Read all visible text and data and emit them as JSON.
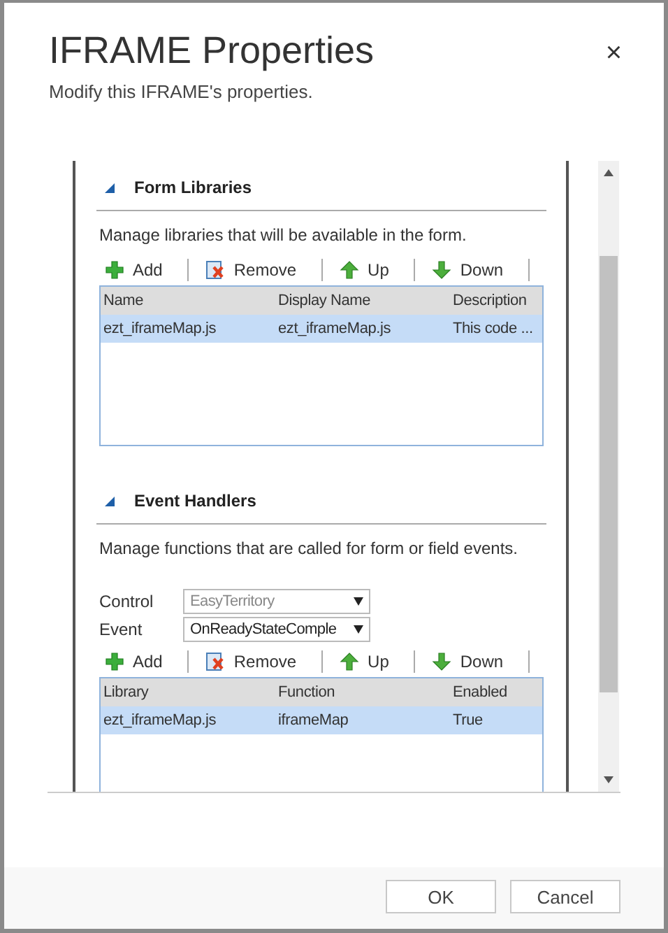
{
  "dialog": {
    "title": "IFRAME Properties",
    "subtitle": "Modify this IFRAME's properties.",
    "close": "×"
  },
  "sections": [
    {
      "title": "Form Libraries",
      "expanded": true,
      "description": "Manage libraries that will be available in the form.",
      "toolbar": [
        {
          "kind": "add",
          "label": "Add"
        },
        {
          "kind": "remove",
          "label": "Remove"
        },
        {
          "kind": "up",
          "label": "Up"
        },
        {
          "kind": "down",
          "label": "Down"
        }
      ],
      "columns": [
        "Name",
        "Display Name",
        "Description"
      ],
      "rows": [
        {
          "cells": [
            "ezt_iframeMap.js",
            "ezt_iframeMap.js",
            "This code ..."
          ],
          "selected": true
        }
      ]
    },
    {
      "title": "Event Handlers",
      "expanded": true,
      "description": "Manage functions that are called for form or field events.",
      "fields": [
        {
          "label": "Control",
          "value": "EasyTerritory",
          "disabled": true
        },
        {
          "label": "Event",
          "value": "OnReadyStateComple",
          "disabled": false
        }
      ],
      "toolbar": [
        {
          "kind": "add",
          "label": "Add"
        },
        {
          "kind": "remove",
          "label": "Remove"
        },
        {
          "kind": "up",
          "label": "Up"
        },
        {
          "kind": "down",
          "label": "Down"
        }
      ],
      "columns": [
        "Library",
        "Function",
        "Enabled"
      ],
      "rows": [
        {
          "cells": [
            "ezt_iframeMap.js",
            "iframeMap",
            "True"
          ],
          "selected": true
        }
      ]
    }
  ],
  "buttons": [
    "OK",
    "Cancel"
  ]
}
